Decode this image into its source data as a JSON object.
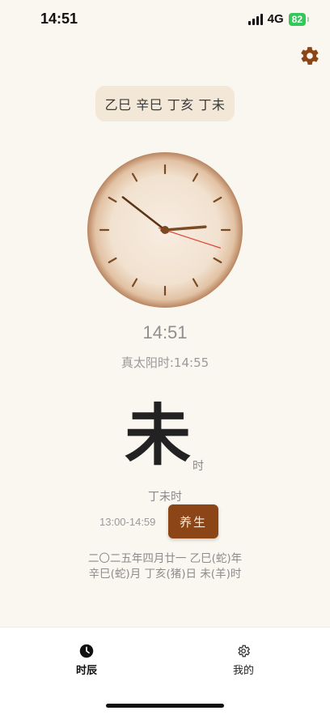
{
  "status_bar": {
    "time": "14:51",
    "network": "4G",
    "battery": "82"
  },
  "header": {
    "settings_icon": "gear-icon",
    "accent": "#8b4516"
  },
  "ganzhi": {
    "text": "乙巳 辛巳 丁亥 丁未"
  },
  "clock": {
    "hour": 14,
    "minute": 51,
    "second": 18
  },
  "time": {
    "digital": "14:51",
    "solar_label": "真太阳时",
    "solar_time": "14:55"
  },
  "shichen": {
    "char": "未",
    "suffix": "时",
    "name": "丁未时",
    "range": "13:00-14:59",
    "button_label": "养生"
  },
  "lunar": {
    "line1": "二〇二五年四月廿一 乙巳(蛇)年",
    "line2": "辛巳(蛇)月 丁亥(猪)日 未(羊)时"
  },
  "tabbar": {
    "home": {
      "label": "时辰",
      "icon": "clock-icon"
    },
    "mine": {
      "label": "我的",
      "icon": "gear-icon"
    }
  }
}
